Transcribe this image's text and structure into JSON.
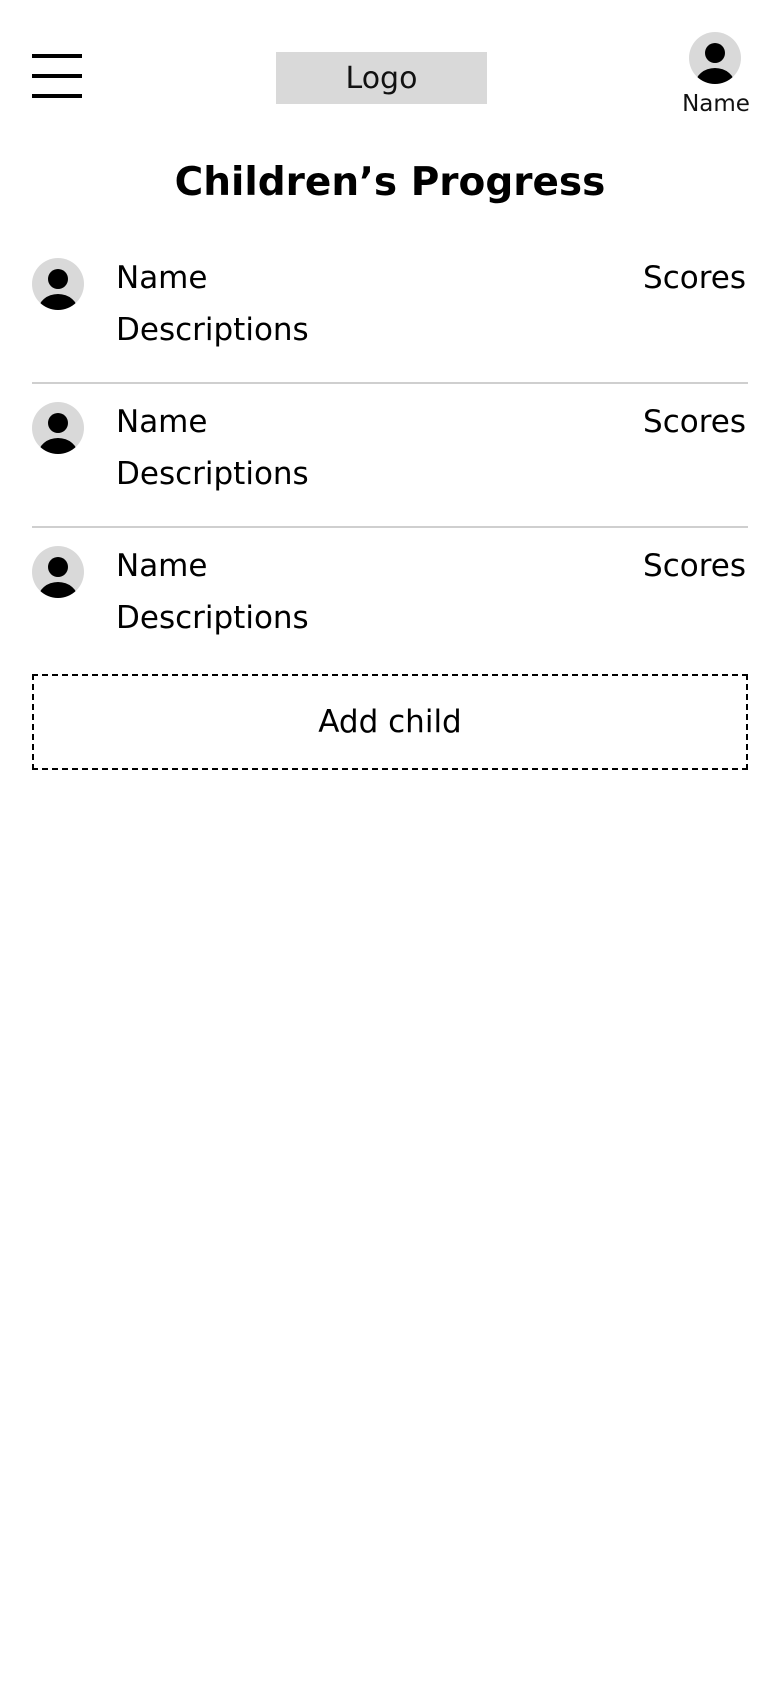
{
  "header": {
    "menu_icon": "hamburger-menu-icon",
    "logo_text": "Logo",
    "user": {
      "avatar_icon": "user-avatar-icon",
      "name": "Name"
    }
  },
  "page": {
    "title": "Children’s Progress"
  },
  "children": [
    {
      "avatar_icon": "user-avatar-icon",
      "name": "Name",
      "scores": "Scores",
      "description": "Descriptions"
    },
    {
      "avatar_icon": "user-avatar-icon",
      "name": "Name",
      "scores": "Scores",
      "description": "Descriptions"
    },
    {
      "avatar_icon": "user-avatar-icon",
      "name": "Name",
      "scores": "Scores",
      "description": "Descriptions"
    }
  ],
  "actions": {
    "add_child_label": "Add child"
  },
  "colors": {
    "background": "#ffffff",
    "placeholder_gray": "#d9d9d9",
    "divider": "#cfcfcf",
    "text": "#000000"
  }
}
